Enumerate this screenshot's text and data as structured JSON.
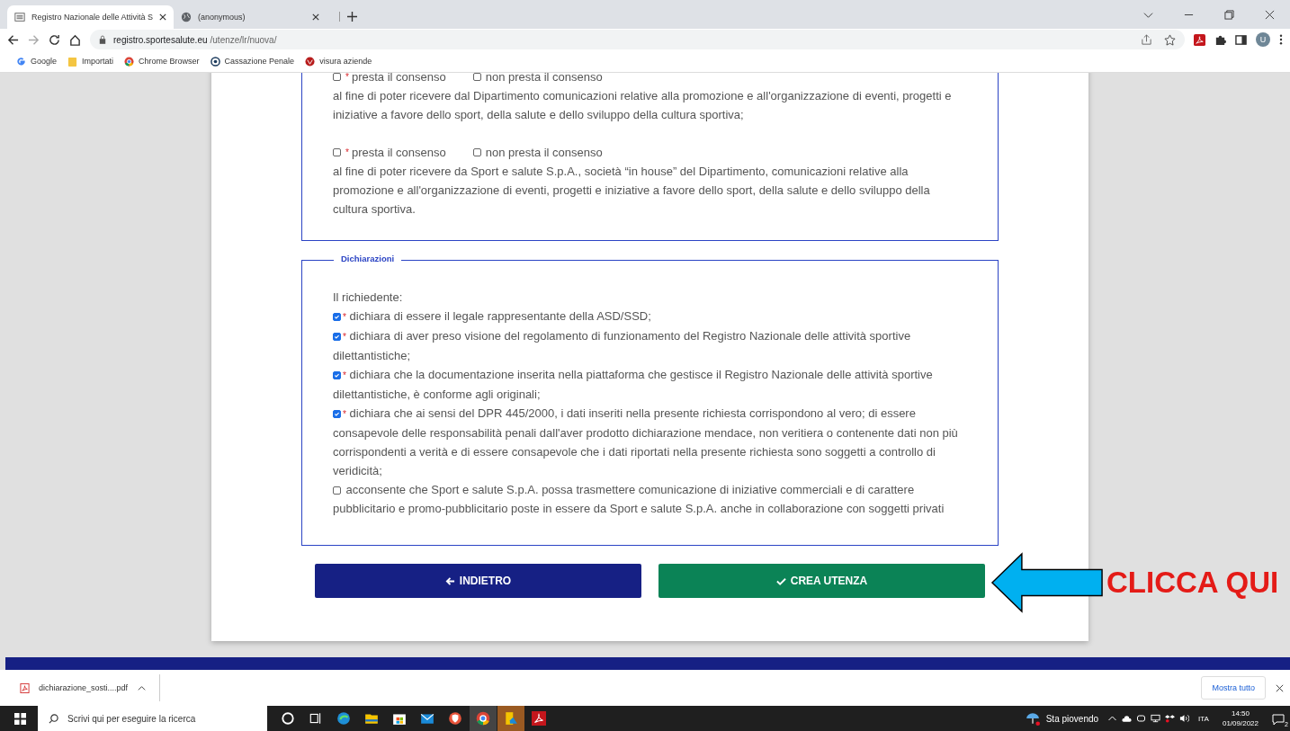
{
  "browser": {
    "tabs": [
      {
        "title": "Registro Nazionale delle Attività S",
        "selected": true
      },
      {
        "title": "(anonymous)",
        "selected": false
      }
    ],
    "url_host": "registro.sportesalute.eu",
    "url_path": "/utenze/lr/nuova/",
    "profile_initial": "U",
    "bookmarks": [
      {
        "label": "Google",
        "kind": "google"
      },
      {
        "label": "Importati",
        "kind": "folder"
      },
      {
        "label": "Chrome Browser",
        "kind": "chrome"
      },
      {
        "label": "Cassazione Penale",
        "kind": "target"
      },
      {
        "label": "visura aziende",
        "kind": "red"
      }
    ]
  },
  "consent_groups": [
    {
      "options": [
        {
          "label": "presta il consenso",
          "required_mark": "*",
          "checked": false
        },
        {
          "label": "non presta il consenso",
          "checked": false
        }
      ],
      "text": "al fine di poter ricevere dal Dipartimento comunicazioni relative alla promozione e all'organizzazione di eventi, progetti e iniziative a favore dello sport, della salute e dello sviluppo della cultura sportiva;"
    },
    {
      "options": [
        {
          "label": "presta il consenso",
          "required_mark": "*",
          "checked": false
        },
        {
          "label": "non presta il consenso",
          "checked": false
        }
      ],
      "text": "al fine di poter ricevere da Sport e salute S.p.A., società “in house” del Dipartimento, comunicazioni relative alla promozione e all'organizzazione di eventi, progetti e iniziative a favore dello sport, della salute e dello sviluppo della cultura sportiva."
    }
  ],
  "declarations": {
    "legend": "Dichiarazioni",
    "intro": "Il richiedente:",
    "items": [
      {
        "checked": true,
        "required_mark": "*",
        "text": "dichiara di essere il legale rappresentante della ASD/SSD;"
      },
      {
        "checked": true,
        "required_mark": "*",
        "text": "dichiara di aver preso visione del regolamento di funzionamento del Registro Nazionale delle attività sportive dilettantistiche;"
      },
      {
        "checked": true,
        "required_mark": "*",
        "text": "dichiara che la documentazione inserita nella piattaforma che gestisce il Registro Nazionale delle attività sportive dilettantistiche, è conforme agli originali;"
      },
      {
        "checked": true,
        "required_mark": "*",
        "text": "dichiara che ai sensi del DPR 445/2000, i dati inseriti nella presente richiesta corrispondono al vero; di essere consapevole delle responsabilità penali dall'aver prodotto dichiarazione mendace, non veritiera o contenente dati non più corrispondenti a verità e di essere consapevole che i dati riportati nella presente richiesta sono soggetti a controllo di veridicità;"
      },
      {
        "checked": false,
        "text": "acconsente che Sport e salute S.p.A. possa trasmettere comunicazione di iniziative commerciali e di carattere pubblicitario e promo-pubblicitario poste in essere da Sport e salute S.p.A. anche in collaborazione con soggetti privati"
      }
    ]
  },
  "buttons": [
    {
      "label": "INDIETRO",
      "kind": "back"
    },
    {
      "label": "CREA UTENZA",
      "kind": "submit"
    }
  ],
  "annotation": {
    "label": "CLICCA QUI"
  },
  "download_bar": {
    "filename": "dichiarazione_sosti....pdf",
    "show_all": "Mostra tutto"
  },
  "taskbar": {
    "search_placeholder": "Scrivi qui per eseguire la ricerca",
    "weather": "Sta piovendo",
    "language": "ITA",
    "time": "14:50",
    "date": "01/09/2022",
    "notifications": "2"
  }
}
